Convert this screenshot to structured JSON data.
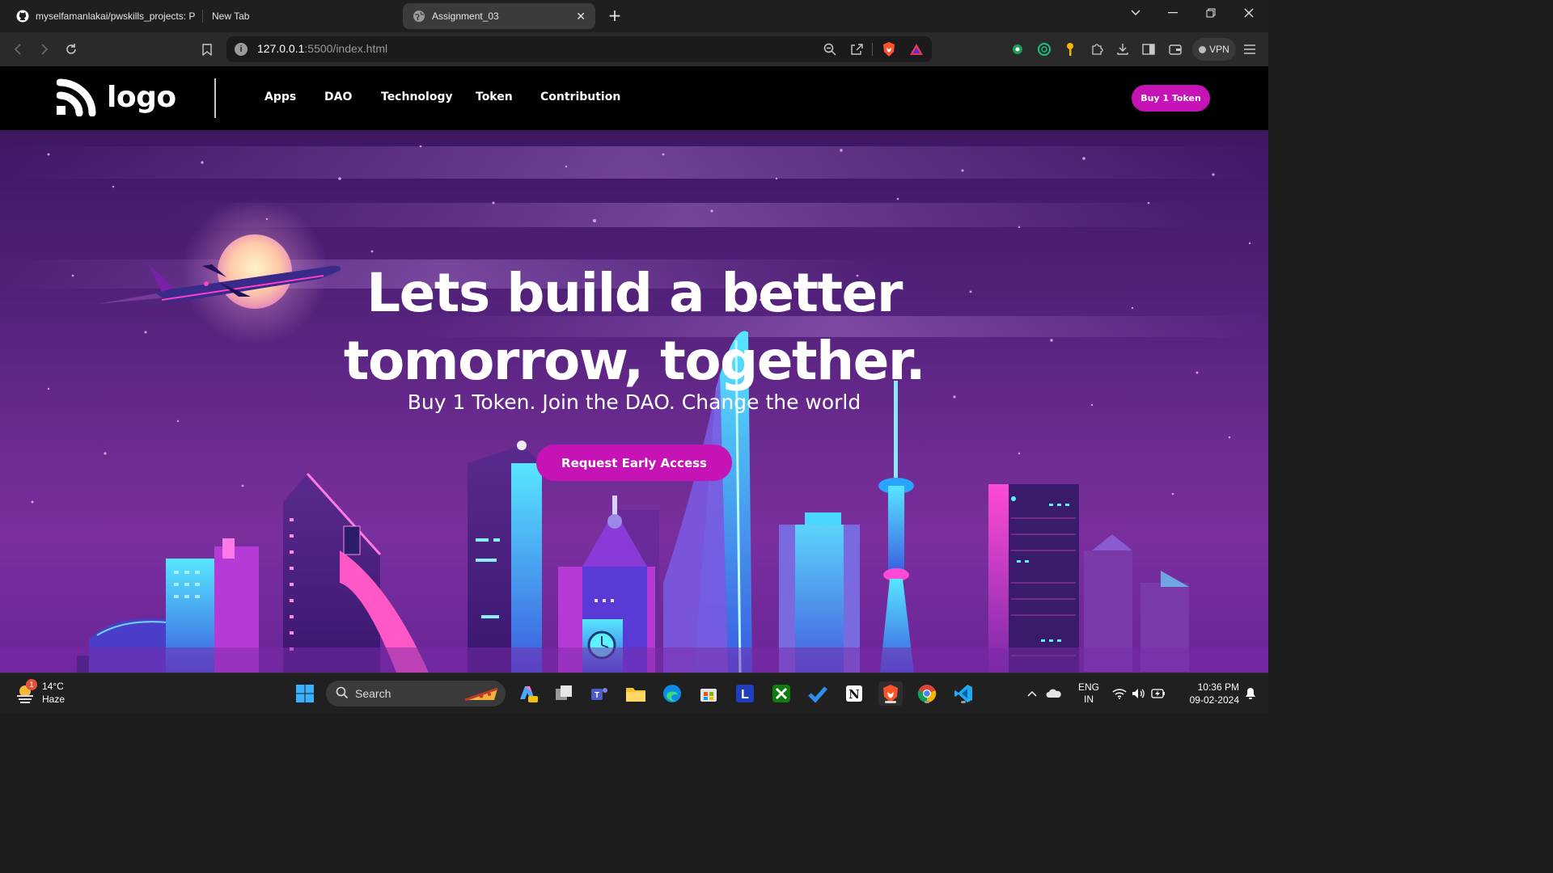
{
  "browser": {
    "tabs": [
      {
        "title": "myselfamanlakai/pwskills_projects: P",
        "icon": "github-icon"
      },
      {
        "title": "New Tab",
        "icon": ""
      },
      {
        "title": "Assignment_03",
        "icon": "globe-icon",
        "active": true
      }
    ],
    "close_tab_glyph": "✕",
    "new_tab_glyph": "+",
    "url_host": "127.0.0.1",
    "url_path": ":5500/index.html",
    "vpn_label": "VPN"
  },
  "site": {
    "logo_text": "logo",
    "nav": [
      "Apps",
      "DAO",
      "Technology",
      "Token",
      "Contribution"
    ],
    "buy_button": "Buy 1 Token",
    "hero_title_line1": "Lets build a better",
    "hero_title_line2": "tomorrow, together.",
    "hero_subtitle": "Buy 1 Token. Join the DAO. Change the world",
    "cta_button": "Request Early Access",
    "accent_color": "#c513b6"
  },
  "taskbar": {
    "weather_temp": "14°C",
    "weather_desc": "Haze",
    "weather_badge": "1",
    "search_placeholder": "Search",
    "language_line1": "ENG",
    "language_line2": "IN",
    "time": "10:36 PM",
    "date": "09-02-2024"
  }
}
